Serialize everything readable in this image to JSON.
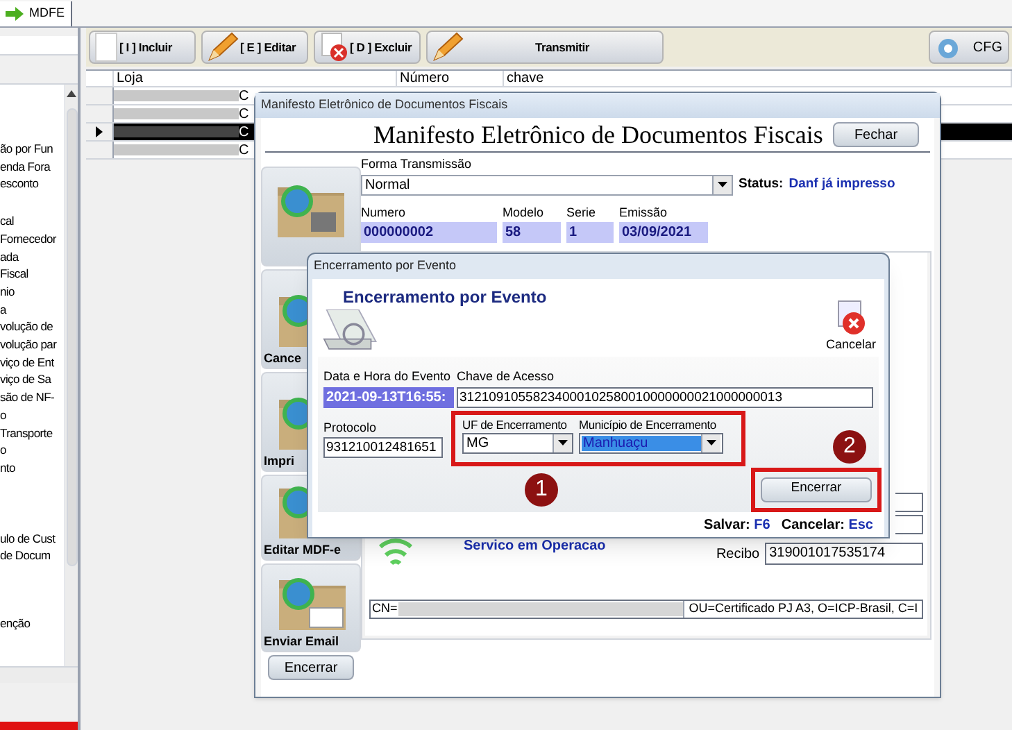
{
  "app_tabs": [
    {
      "label": "MDFE",
      "selected": true
    }
  ],
  "sidebar": {
    "groups": [
      [
        "ão por Fun",
        "enda Fora",
        "esconto"
      ],
      [
        "cal",
        "Fornecedor",
        "ada",
        "Fiscal",
        "nio",
        "a",
        "volução de",
        "volução par",
        "viço de Ent",
        "viço de Sa",
        "são de NF-",
        "o",
        "Transporte",
        "o",
        "nto"
      ],
      [
        "ulo de Cust",
        "de Docum"
      ],
      [
        "enção"
      ]
    ]
  },
  "toolbar": {
    "buttons": [
      {
        "label": "[ I ] Incluir",
        "kind": "add"
      },
      {
        "label": "[ E ] Editar",
        "kind": "edit"
      },
      {
        "label": "[ D ] Excluir",
        "kind": "delete"
      },
      {
        "label": "Transmitir",
        "kind": "send"
      }
    ],
    "config_button": "CFG"
  },
  "grid": {
    "columns": [
      "Loja",
      "Número",
      "chave"
    ],
    "rows": [
      {
        "loja": "C",
        "selected": false
      },
      {
        "loja": "C",
        "selected": false
      },
      {
        "loja": "C",
        "selected": true
      },
      {
        "loja": "C",
        "selected": false
      }
    ]
  },
  "mdfe_window": {
    "title": "Manifesto Eletrônico de Documentos Fiscais",
    "heading": "Manifesto Eletrônico de Documentos Fiscais",
    "close_button": "Fechar",
    "side_buttons": [
      "Cance",
      "Impri",
      "Editar MDF-e",
      "Enviar Email"
    ],
    "encerrar_button": "Encerrar",
    "forma_label": "Forma Transmissão",
    "forma_value": "Normal",
    "status_label": "Status:",
    "status_value": "Danf já impresso",
    "fields": [
      {
        "label": "Numero",
        "value": "000000002"
      },
      {
        "label": "Modelo",
        "value": "58"
      },
      {
        "label": "Serie",
        "value": "1"
      },
      {
        "label": "Emissão",
        "value": "03/09/2021"
      }
    ],
    "service_status": "Servico em Operacao",
    "recibo_label": "Recibo",
    "recibo_value": "319001017535174",
    "certificate_prefix": "CN=",
    "certificate_suffix": "OU=Certificado PJ A3, O=ICP-Brasil, C=I"
  },
  "event_dialog": {
    "title": "Encerramento por Evento",
    "heading": "Encerramento por Evento",
    "cancel_label": "Cancelar",
    "date_label": "Data e Hora do Evento",
    "date_value": "2021-09-13T16:55:",
    "key_label": "Chave de Acesso",
    "key_value": "31210910558234000102580010000000021000000013",
    "protocolo_label": "Protocolo",
    "protocolo_value": "931210012481651",
    "uf_label": "UF de Encerramento",
    "uf_value": "MG",
    "municipio_label": "Município de Encerramento",
    "municipio_value": "Manhuaçu",
    "submit_button": "Encerrar",
    "shortcuts": [
      {
        "label": "Salvar:",
        "key": "F6"
      },
      {
        "label": "Cancelar:",
        "key": "Esc"
      }
    ]
  },
  "annotations": [
    {
      "number": "1"
    },
    {
      "number": "2"
    }
  ]
}
